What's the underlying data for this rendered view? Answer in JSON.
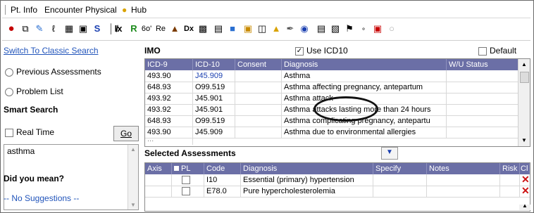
{
  "menu": {
    "items": [
      "Pt. Info",
      "Encounter",
      "Physical",
      "Hub"
    ]
  },
  "toolbar": {
    "labels": [
      "S",
      "R",
      "6o'",
      "Re",
      "Dx"
    ]
  },
  "left": {
    "classic_link": "Switch To Classic Search",
    "radio_prev": "Previous Assessments",
    "radio_problem": "Problem List",
    "smart_search": "Smart Search",
    "real_time": "Real Time",
    "go": "Go",
    "search_value": "asthma",
    "did_you_mean": "Did you mean?",
    "no_suggestions": "-- No Suggestions --"
  },
  "imo": {
    "title": "IMO",
    "use_icd10": "Use ICD10",
    "default": "Default",
    "columns": [
      "ICD-9",
      "ICD-10",
      "Consent",
      "Diagnosis",
      "W/U Status"
    ],
    "rows": [
      {
        "icd9": "493.90",
        "icd10": "J45.909",
        "consent": "",
        "diagnosis": "Asthma",
        "status": ""
      },
      {
        "icd9": "648.93",
        "icd10": "O99.519",
        "consent": "",
        "diagnosis": "Asthma affecting pregnancy, antepartum",
        "status": ""
      },
      {
        "icd9": "493.92",
        "icd10": "J45.901",
        "consent": "",
        "diagnosis": "Asthma attack",
        "status": ""
      },
      {
        "icd9": "493.92",
        "icd10": "J45.901",
        "consent": "",
        "diagnosis": "Asthma attacks lasting more than 24 hours",
        "status": ""
      },
      {
        "icd9": "648.93",
        "icd10": "O99.519",
        "consent": "",
        "diagnosis": "Asthma complicating pregnancy, antepartu",
        "status": ""
      },
      {
        "icd9": "493.90",
        "icd10": "J45.909",
        "consent": "",
        "diagnosis": "Asthma due to environmental allergies",
        "status": ""
      }
    ]
  },
  "selected": {
    "title": "Selected Assessments",
    "columns": [
      "Axis",
      "PL",
      "Code",
      "Diagnosis",
      "Specify",
      "Notes",
      "Risk",
      "Cl"
    ],
    "rows": [
      {
        "axis": "",
        "code": "I10",
        "diagnosis": "Essential (primary) hypertension",
        "specify": "",
        "notes": "",
        "risk": ""
      },
      {
        "axis": "",
        "code": "E78.0",
        "diagnosis": "Pure hypercholesterolemia",
        "specify": "",
        "notes": "",
        "risk": ""
      }
    ]
  },
  "colors": {
    "header": "#6b6fa6",
    "link": "#2255bb",
    "remove": "#cc1111"
  }
}
